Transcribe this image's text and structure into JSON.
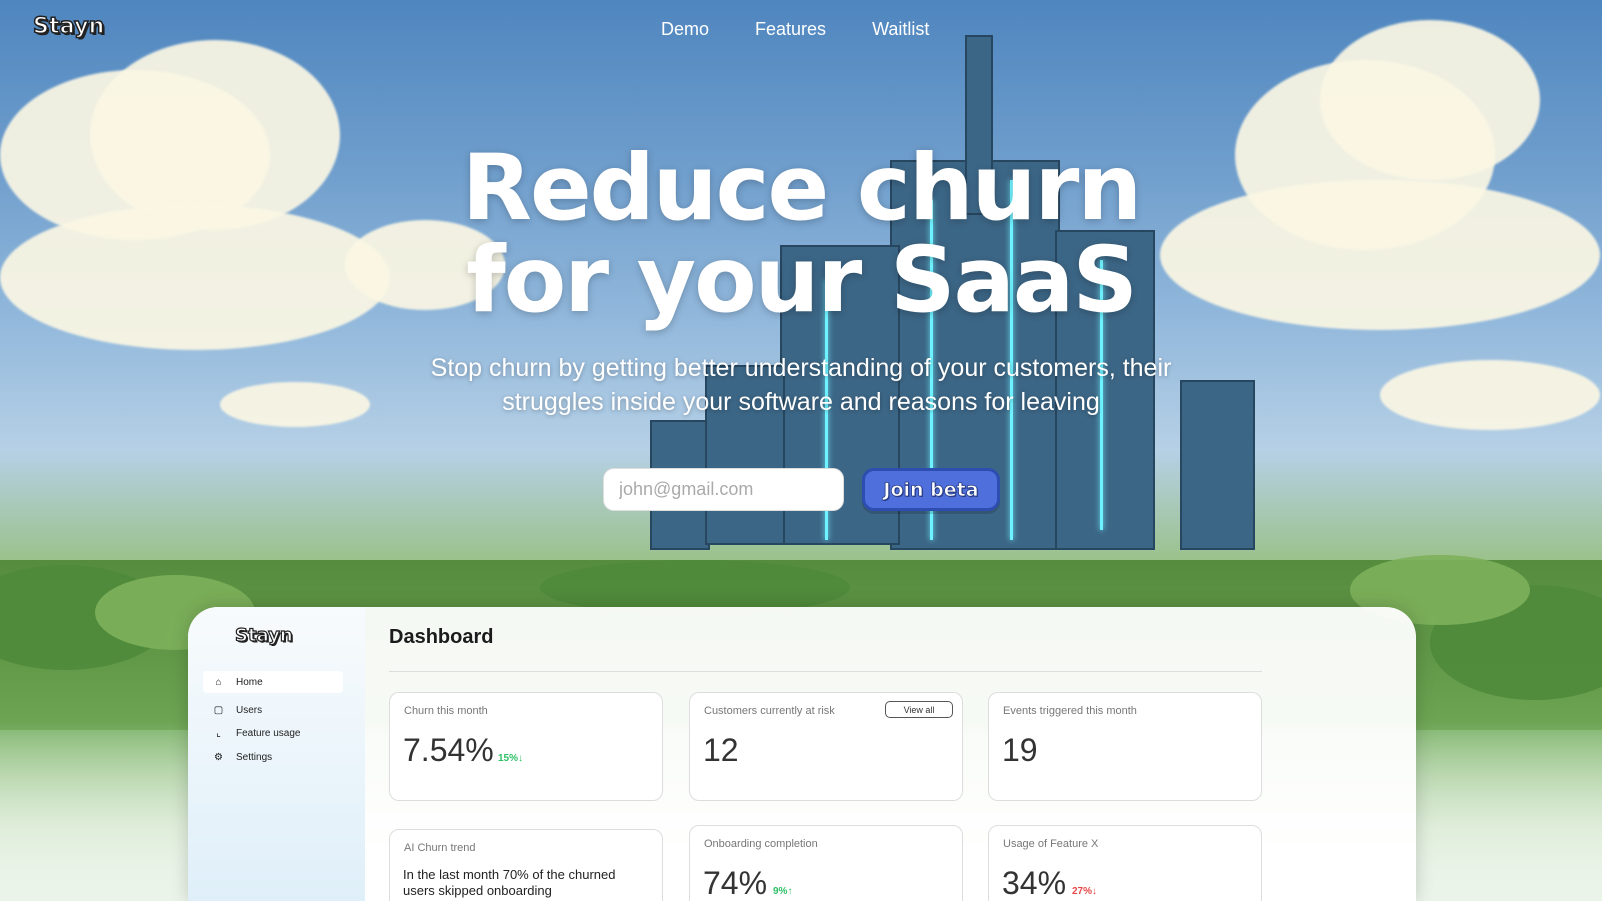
{
  "top": {
    "logo": "Stayn",
    "nav": [
      "Demo",
      "Features",
      "Waitlist"
    ]
  },
  "hero": {
    "title_line_1": "Reduce churn",
    "title_line_2": "for your SaaS",
    "subtitle_line_1": "Stop churn by getting better understanding of your customers, their",
    "subtitle_line_2": "struggles inside your software and reasons for leaving",
    "email_placeholder": "john@gmail.com",
    "join_label": "Join beta"
  },
  "app": {
    "logo": "Stayn",
    "sidebar": [
      {
        "label": "Home",
        "icon": "home-icon"
      },
      {
        "label": "Users",
        "icon": "file-icon"
      },
      {
        "label": "Feature usage",
        "icon": "chart-line-icon"
      },
      {
        "label": "Settings",
        "icon": "gear-icon"
      }
    ],
    "title": "Dashboard",
    "cards": {
      "churn": {
        "label": "Churn this month",
        "value": "7.54%",
        "delta": "15%↓"
      },
      "at_risk": {
        "label": "Customers currently at risk",
        "value": "12",
        "action": "View all"
      },
      "events": {
        "label": "Events triggered this month",
        "value": "19"
      },
      "ai_trend": {
        "label": "AI Churn trend",
        "text": "In the last month 70% of the churned users skipped onboarding"
      },
      "onboarding": {
        "label": "Onboarding completion",
        "value": "74%",
        "delta": "9%↑"
      },
      "feature_x": {
        "label": "Usage of Feature X",
        "value": "34%",
        "delta": "27%↓"
      }
    }
  },
  "colors": {
    "sky": "#4f86bf",
    "button": "#4f70dc",
    "positive": "#2ebf65",
    "negative": "#e64848"
  }
}
